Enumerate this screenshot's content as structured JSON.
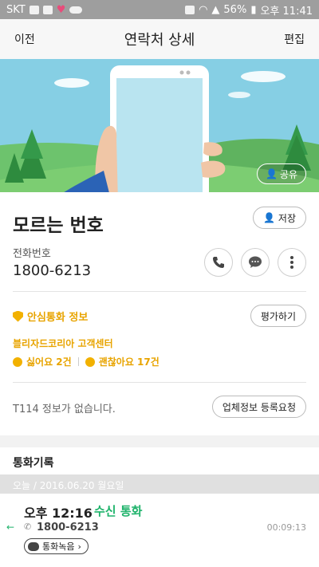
{
  "status_bar": {
    "carrier": "SKT",
    "battery": "56%",
    "time": "오후 11:41"
  },
  "header": {
    "back_label": "이전",
    "title": "연락처 상세",
    "edit_label": "편집"
  },
  "banner": {
    "share_label": "공유"
  },
  "contact": {
    "name": "모르는 번호",
    "save_label": "저장",
    "phone_label": "전화번호",
    "phone_number": "1800-6213"
  },
  "safe_call": {
    "title": "안심통화 정보",
    "rate_label": "평가하기",
    "company": "블리자드코리아 고객센터",
    "dislike_label": "싫어요 2건",
    "like_label": "괜찮아요 17건"
  },
  "t114": {
    "message": "T114 정보가 없습니다.",
    "register_label": "업체정보 등록요청"
  },
  "call_log": {
    "title": "통화기록",
    "date": "오늘 / 2016.06.20 월요일",
    "entries": [
      {
        "time": "오후 12:16",
        "type": "수신 통화",
        "number": "1800-6213",
        "duration": "00:09:13",
        "recording_label": "통화녹음"
      }
    ]
  },
  "colors": {
    "accent_orange": "#e8a400",
    "incoming_green": "#1fb36b",
    "banner_sky": "#8ad2e6"
  }
}
